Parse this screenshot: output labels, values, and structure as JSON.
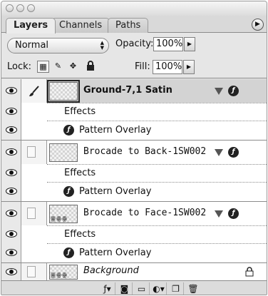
{
  "tabs": [
    "Layers",
    "Channels",
    "Paths"
  ],
  "blend_mode": "Normal",
  "opacity_label": "Opacity:",
  "opacity_value": "100%",
  "lock_label": "Lock:",
  "fill_label": "Fill:",
  "fill_value": "100%",
  "layers": [
    {
      "name": "Ground-7,1 Satin",
      "selected": true,
      "effects_label": "Effects",
      "effect": "Pattern Overlay"
    },
    {
      "name": "Brocade to Back-1SW002",
      "selected": false,
      "effects_label": "Effects",
      "effect": "Pattern Overlay"
    },
    {
      "name": "Brocade to Face-1SW002",
      "selected": false,
      "effects_label": "Effects",
      "effect": "Pattern Overlay"
    },
    {
      "name": "Background",
      "selected": false,
      "locked": true
    }
  ],
  "icons": {
    "menu": "panel-menu-icon",
    "visibility": "eye-icon",
    "brush": "paintbrush-icon",
    "fx": "layer-effects-icon",
    "lock": "lock-icon"
  },
  "colors": {
    "panel": "#e6e6e6",
    "selected_row": "#d3d3d3"
  }
}
